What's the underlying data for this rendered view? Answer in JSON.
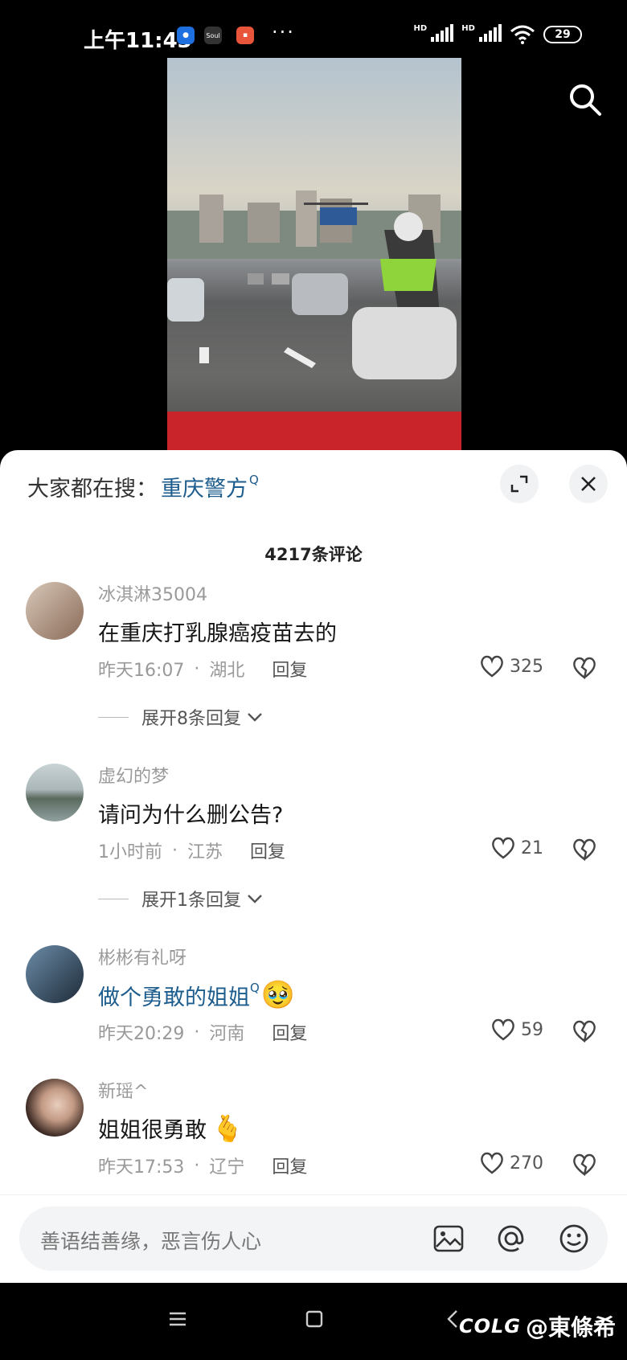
{
  "status_bar": {
    "time": "上午11:43",
    "app_badges": [
      "Soul"
    ],
    "more": "···",
    "network_label": "HD",
    "battery": "29"
  },
  "hot_search": {
    "prefix": "大家都在搜：",
    "term": "重庆警方"
  },
  "comment_count": "4217条评论",
  "comments": [
    {
      "username": "冰淇淋35004",
      "text": "在重庆打乳腺癌疫苗去的",
      "time": "昨天16:07",
      "location": "湖北",
      "reply_label": "回复",
      "likes": "325",
      "expand": "展开8条回复"
    },
    {
      "username": "虚幻的梦",
      "text": "请问为什么删公告?",
      "time": "1小时前",
      "location": "江苏",
      "reply_label": "回复",
      "likes": "21",
      "expand": "展开1条回复"
    },
    {
      "username": "彬彬有礼呀",
      "text": "做个勇敢的姐姐",
      "time": "昨天20:29",
      "location": "河南",
      "reply_label": "回复",
      "likes": "59"
    },
    {
      "username": "新瑶^",
      "text": "姐姐很勇敢",
      "time": "昨天17:53",
      "location": "辽宁",
      "reply_label": "回复",
      "likes": "270"
    }
  ],
  "input": {
    "placeholder": "善语结善缘，恶言伤人心"
  },
  "watermark": {
    "logo": "COLG",
    "handle": "@東條希"
  },
  "colors": {
    "link": "#1d5d8e",
    "sheet_bg": "#ffffff",
    "status_bg": "#000000"
  },
  "icons": [
    "search-icon",
    "expand-icon",
    "close-icon",
    "heart-icon",
    "broken-heart-icon",
    "image-icon",
    "at-icon",
    "emoji-icon",
    "menu-icon",
    "home-icon",
    "back-icon"
  ]
}
